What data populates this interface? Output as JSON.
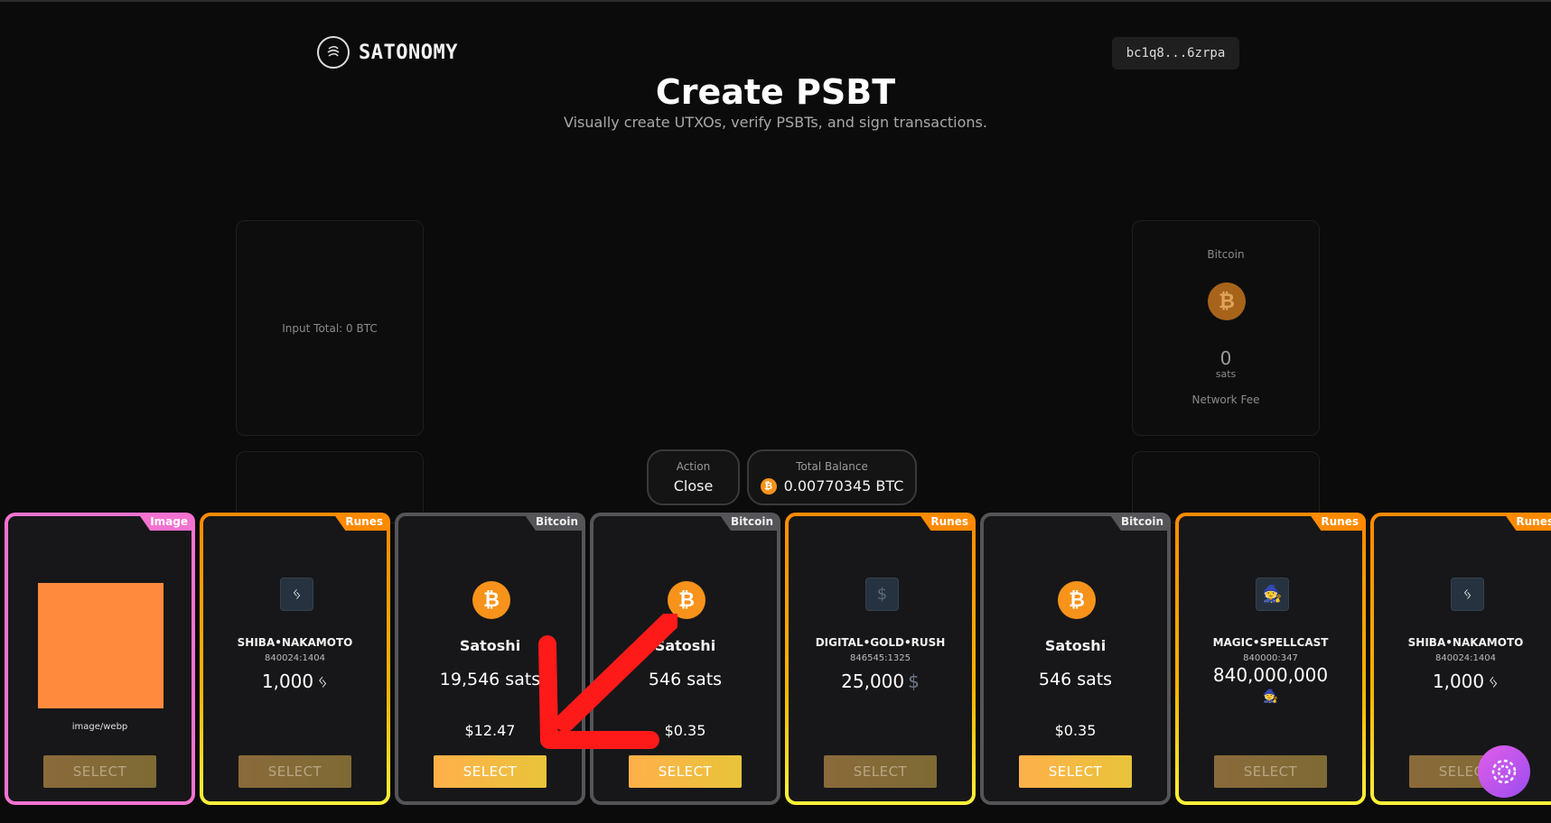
{
  "header": {
    "logo_text": "SATONOMY",
    "wallet": "bc1q8...6zrpa",
    "title": "Create PSBT",
    "subtitle": "Visually create UTXOs, verify PSBTs, and sign transactions."
  },
  "input_panel": {
    "total": "Input Total: 0 BTC"
  },
  "fee_panel": {
    "label": "Bitcoin",
    "icon": "bitcoin-icon",
    "value": "0",
    "unit": "sats",
    "caption": "Network Fee"
  },
  "action": {
    "label": "Action",
    "value": "Close"
  },
  "balance": {
    "label": "Total Balance",
    "value": "0.00770345 BTC",
    "coin": "₿"
  },
  "cards": [
    {
      "tag": "Image",
      "mime": "image/webp",
      "button": "SELECT"
    },
    {
      "tag": "Runes",
      "symbol": "ᛃ",
      "name": "SHIBA•NAKAMOTO",
      "id": "840024:1404",
      "amount": "1,000",
      "button": "SELECT"
    },
    {
      "tag": "Bitcoin",
      "coin": "₿",
      "name": "Satoshi",
      "sats": "19,546 sats",
      "usd": "$12.47",
      "button": "SELECT"
    },
    {
      "tag": "Bitcoin",
      "coin": "₿",
      "name": "Satoshi",
      "sats": "546 sats",
      "usd": "$0.35",
      "button": "SELECT"
    },
    {
      "tag": "Runes",
      "symbol": "$",
      "name": "DIGITAL•GOLD•RUSH",
      "id": "846545:1325",
      "amount": "25,000",
      "button": "SELECT"
    },
    {
      "tag": "Bitcoin",
      "coin": "₿",
      "name": "Satoshi",
      "sats": "546 sats",
      "usd": "$0.35",
      "button": "SELECT"
    },
    {
      "tag": "Runes",
      "symbol": "🧙",
      "name": "MAGIC•SPELLCAST",
      "id": "840000:347",
      "amount": "840,000,000",
      "button": "SELECT"
    },
    {
      "tag": "Runes",
      "symbol": "ᛃ",
      "name": "SHIBA•NAKAMOTO",
      "id": "840024:1404",
      "amount": "1,000",
      "button": "SELECT"
    }
  ],
  "colors": {
    "accent": "#f7931a",
    "runes": "#ff8a00",
    "image": "#f472d0",
    "bitcoin_tag": "#555559"
  }
}
